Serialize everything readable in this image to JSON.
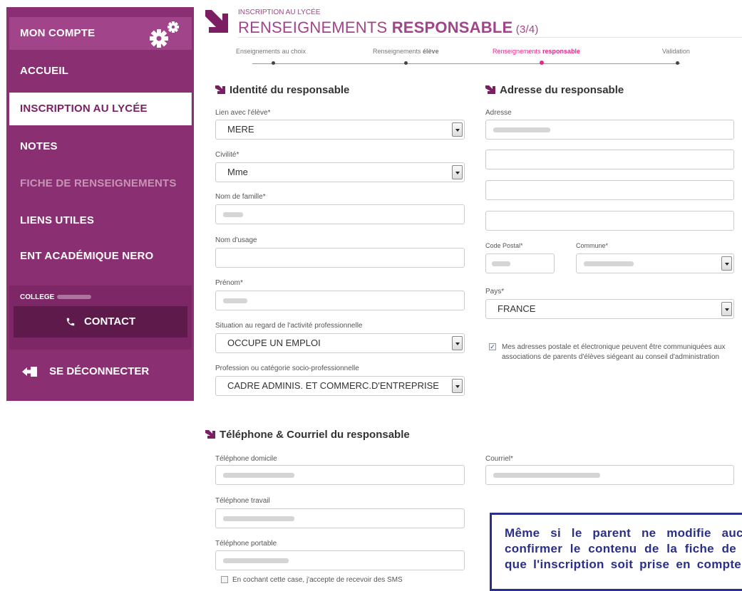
{
  "sidebar": {
    "items": [
      {
        "label": "MON COMPTE"
      },
      {
        "label": "ACCUEIL"
      },
      {
        "label": "INSCRIPTION AU LYCÉE"
      },
      {
        "label": "NOTES"
      },
      {
        "label": "FICHE DE RENSEIGNEMENTS"
      },
      {
        "label": "LIENS UTILES"
      },
      {
        "label": "ENT ACADÉMIQUE NERO"
      }
    ],
    "college_label": "COLLEGE",
    "contact_label": "CONTACT",
    "logout_label": "SE DÉCONNECTER"
  },
  "header": {
    "subtitle": "INSCRIPTION AU LYCÉE",
    "title_part1": "RENSEIGNEMENTS ",
    "title_part2": "RESPONSABLE",
    "step": " (3/4)"
  },
  "steps": [
    {
      "label": "Enseignements au choix",
      "bold": ""
    },
    {
      "label": "Renseignements ",
      "bold": "élève"
    },
    {
      "label": "Renseignements ",
      "bold": "responsable"
    },
    {
      "label": "Validation",
      "bold": ""
    }
  ],
  "identity": {
    "title": "Identité du responsable",
    "lien_label": "Lien avec l'élève*",
    "lien_value": "MERE",
    "civilite_label": "Civilité*",
    "civilite_value": "Mme",
    "nom_label": "Nom de famille*",
    "usage_label": "Nom d'usage",
    "prenom_label": "Prénom*",
    "situation_label": "Situation au regard de l'activité professionnelle",
    "situation_value": "OCCUPE UN EMPLOI",
    "profession_label": "Profession ou catégorie socio-professionnelle",
    "profession_value": "CADRE ADMINIS. ET COMMERC.D'ENTREPRISE"
  },
  "address": {
    "title": "Adresse du responsable",
    "adresse_label": "Adresse",
    "cp_label": "Code Postal*",
    "commune_label": "Commune*",
    "pays_label": "Pays*",
    "pays_value": "FRANCE",
    "consent_text": "Mes adresses postale et électronique peuvent être communiquées aux associations de parents d'élèves siégeant au conseil d'administration"
  },
  "contact": {
    "title": "Téléphone & Courriel du responsable",
    "tel_dom_label": "Téléphone domicile",
    "tel_trav_label": "Téléphone travail",
    "tel_port_label": "Téléphone portable",
    "courriel_label": "Courriel*",
    "sms_text": "En cochant cette case, j'accepte de recevoir des SMS"
  },
  "note": {
    "text": "Même si le parent ne modifie aucune donnée, il doit confirmer le contenu de la fiche de renseignements pour que l'inscription soit prise en compte"
  },
  "colors": {
    "sidebar": "#8b2f73",
    "accent": "#a2448a",
    "step_active": "#e02a88",
    "note_border": "#2a2f8c"
  }
}
